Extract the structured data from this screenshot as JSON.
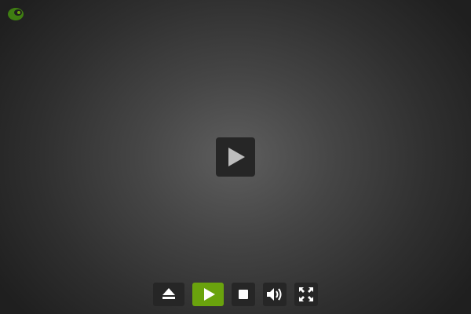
{
  "player": {
    "logo_icon": "player-logo-icon",
    "big_play_icon": "play-icon",
    "accent_color": "#6aa30d",
    "button_color": "#262626"
  },
  "controls": [
    {
      "name": "eject-button",
      "icon": "eject-icon",
      "active": false
    },
    {
      "name": "play-button",
      "icon": "play-icon",
      "active": true
    },
    {
      "name": "stop-button",
      "icon": "stop-icon",
      "active": false
    },
    {
      "name": "volume-button",
      "icon": "volume-icon",
      "active": false
    },
    {
      "name": "fullscreen-button",
      "icon": "fullscreen-icon",
      "active": false
    }
  ]
}
